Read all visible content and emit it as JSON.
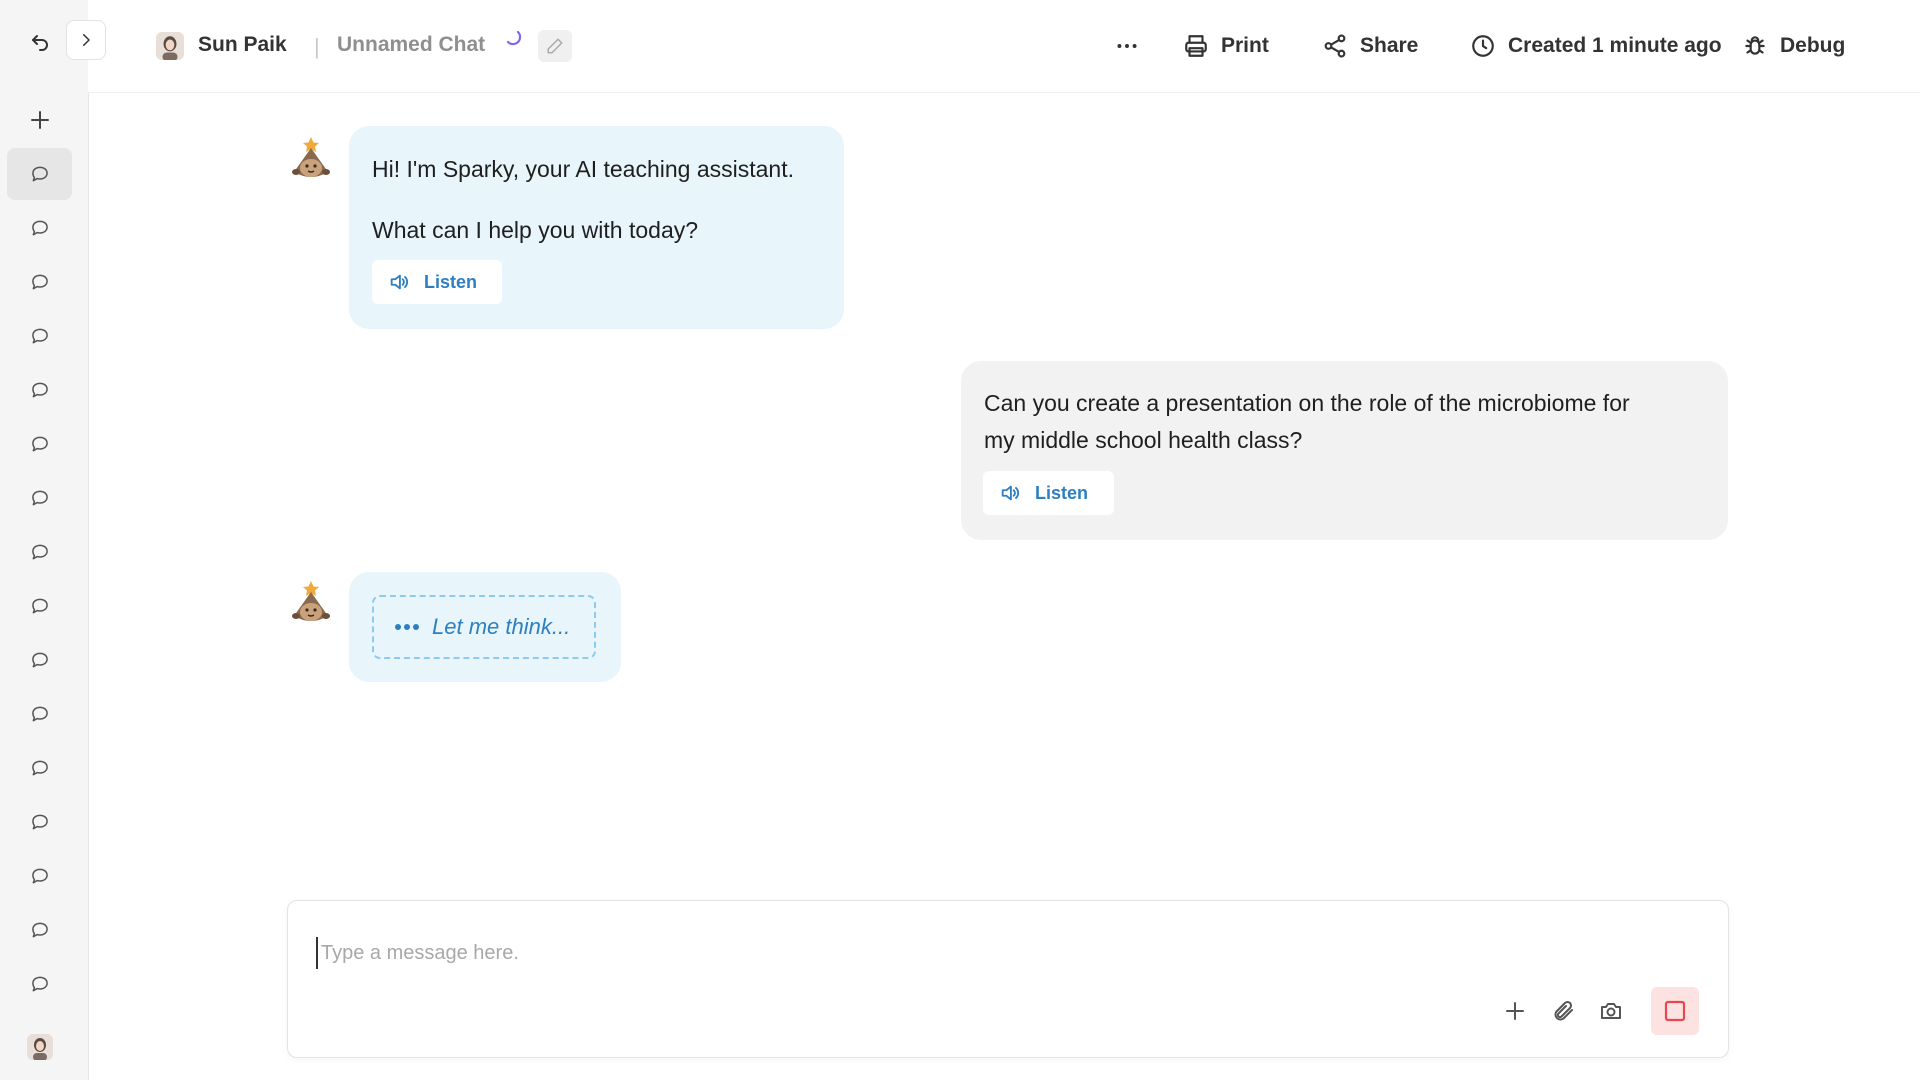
{
  "header": {
    "user_name": "Sun Paik",
    "separator": "|",
    "chat_title": "Unnamed Chat",
    "actions": {
      "print_label": "Print",
      "share_label": "Share",
      "created_label": "Created 1 minute ago",
      "debug_label": "Debug"
    }
  },
  "sidebar": {
    "icons": [
      "back-icon",
      "chevron-right-icon",
      "plus-icon",
      "chat-bubble-icon"
    ],
    "chat_count": 16
  },
  "messages": [
    {
      "role": "assistant",
      "paragraphs": [
        "Hi! I'm Sparky, your AI teaching assistant.",
        "What can I help you with today?"
      ],
      "listen_label": "Listen"
    },
    {
      "role": "user",
      "lines": [
        "Can you create a presentation on the role of the microbiome for",
        "my middle school health class?"
      ],
      "listen_label": "Listen"
    },
    {
      "role": "assistant",
      "thinking_label": "Let me think..."
    }
  ],
  "composer": {
    "placeholder": "Type a message here.",
    "value": ""
  },
  "colors": {
    "bot_bubble": "#e8f5fa",
    "user_bubble": "#f2f2f2",
    "accent_blue": "#2d7fc1",
    "stop_button": "#fde2e2",
    "stop_icon": "#e5484d"
  }
}
